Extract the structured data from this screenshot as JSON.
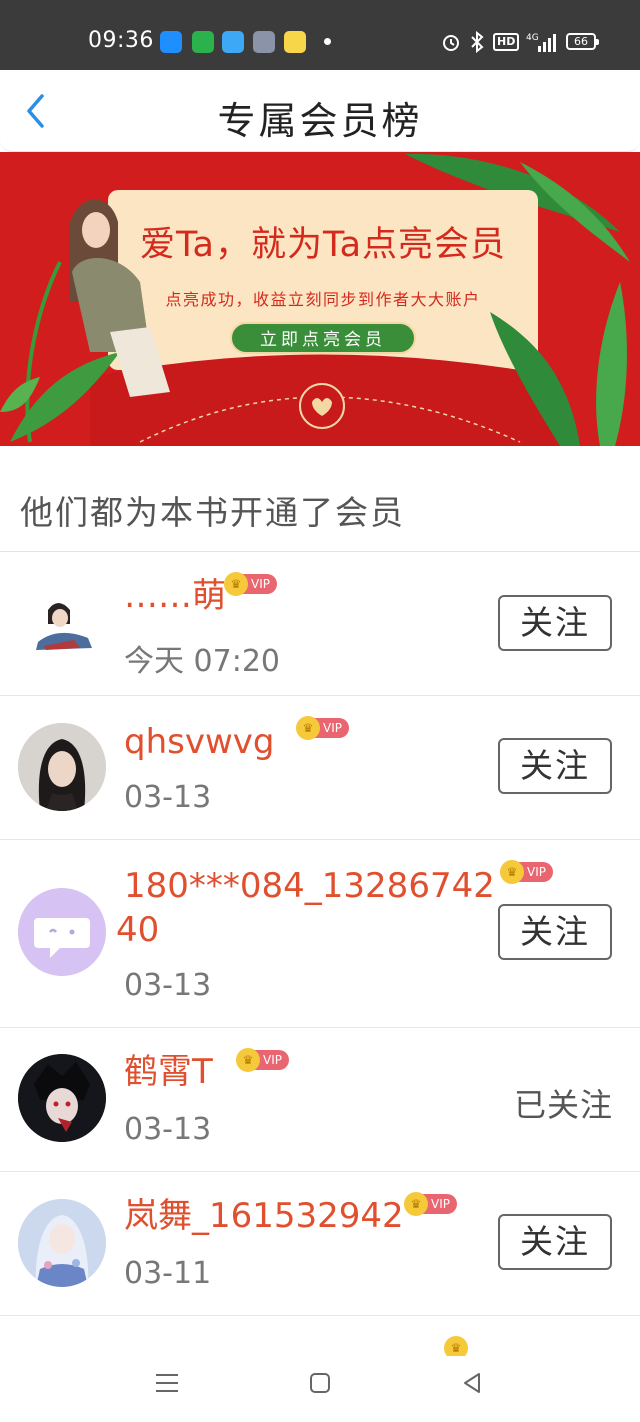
{
  "status_bar": {
    "time": "09:36",
    "hd_badge": "HD",
    "network": "4G",
    "battery": "66",
    "app_icon_colors": [
      "#1f8fff",
      "#2bb24c",
      "#3da8f5",
      "#8b93a8",
      "#f7d64a"
    ]
  },
  "header": {
    "title": "专属会员榜",
    "back_icon": "chevron-left-icon"
  },
  "banner": {
    "headline": "爱Ta，就为Ta点亮会员",
    "subline": "点亮成功，收益立刻同步到作者大大账户",
    "cta": "立即点亮会员",
    "colors": {
      "background": "#d21d1f",
      "card": "#fbe5c3",
      "cta": "#3a8e3a"
    }
  },
  "section": {
    "title": "他们都为本书开通了会员"
  },
  "members": [
    {
      "name": "……萌",
      "date": "今天 07:20",
      "vip": "VIP",
      "action": "关注",
      "followed": false
    },
    {
      "name": "qhsvwvg",
      "date": "03-13",
      "vip": "VIP",
      "action": "关注",
      "followed": false
    },
    {
      "name_line1": "180***084_13286742",
      "name_line2": "40",
      "date": "03-13",
      "vip": "VIP",
      "action": "关注",
      "followed": false
    },
    {
      "name": "鹤霄T",
      "date": "03-13",
      "vip": "VIP",
      "action": "已关注",
      "followed": true
    },
    {
      "name": "岚舞_161532942",
      "date": "03-11",
      "vip": "VIP",
      "action": "关注",
      "followed": false
    }
  ],
  "colors": {
    "accent_name": "#e0502f",
    "vip_tag": "#e9656f",
    "crown": "#f5c93a"
  }
}
